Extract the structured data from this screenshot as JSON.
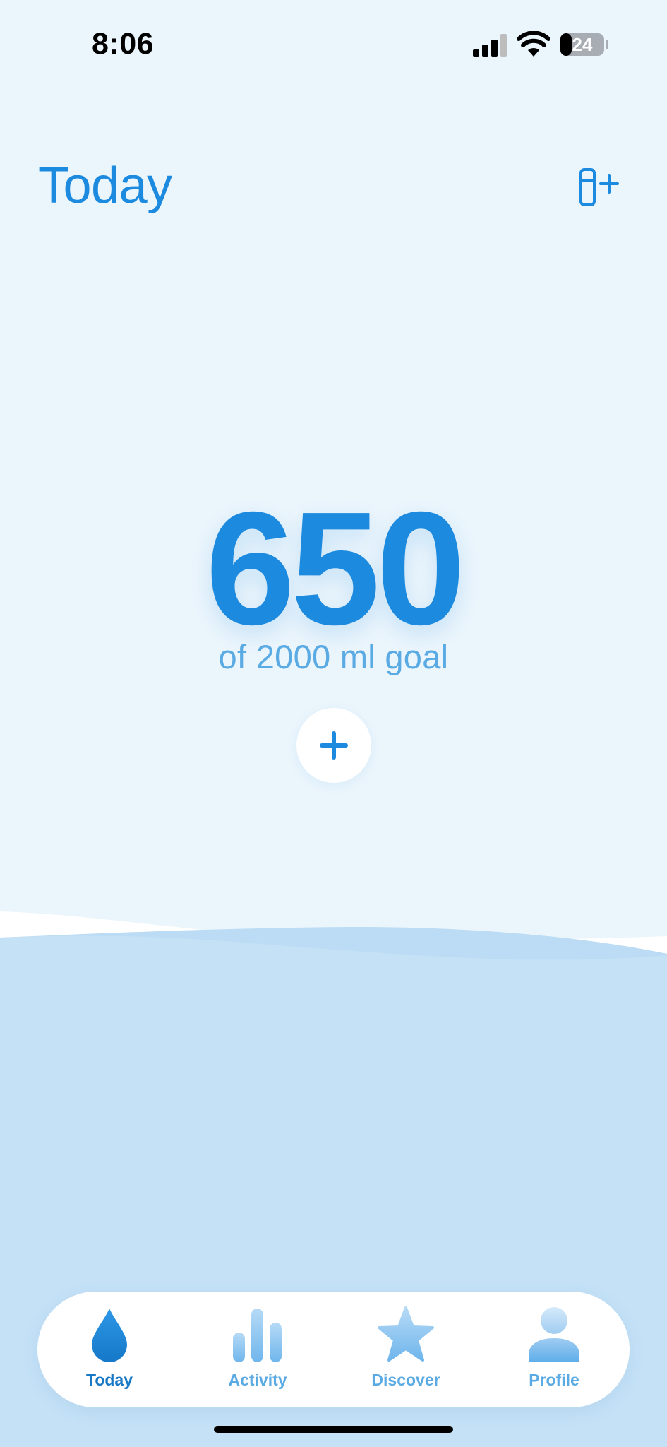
{
  "status_bar": {
    "time": "8:06",
    "battery": "24",
    "icons": [
      "signal-icon",
      "wifi-icon",
      "battery-icon"
    ]
  },
  "header": {
    "title": "Today",
    "action_icon": "add-container-icon"
  },
  "intake": {
    "value": "650",
    "goal_text": "of 2000 ml goal",
    "add_icon": "plus-icon"
  },
  "tab_bar": {
    "items": [
      {
        "label": "Today",
        "icon": "water-drop-icon",
        "active": true
      },
      {
        "label": "Activity",
        "icon": "bar-chart-icon",
        "active": false
      },
      {
        "label": "Discover",
        "icon": "star-icon",
        "active": false
      },
      {
        "label": "Profile",
        "icon": "person-icon",
        "active": false
      }
    ]
  },
  "colors": {
    "accent": "#1C8ADF",
    "background": "#EBF5FC",
    "water": "#C4E1F6",
    "secondary_text": "#5AAAE3"
  }
}
